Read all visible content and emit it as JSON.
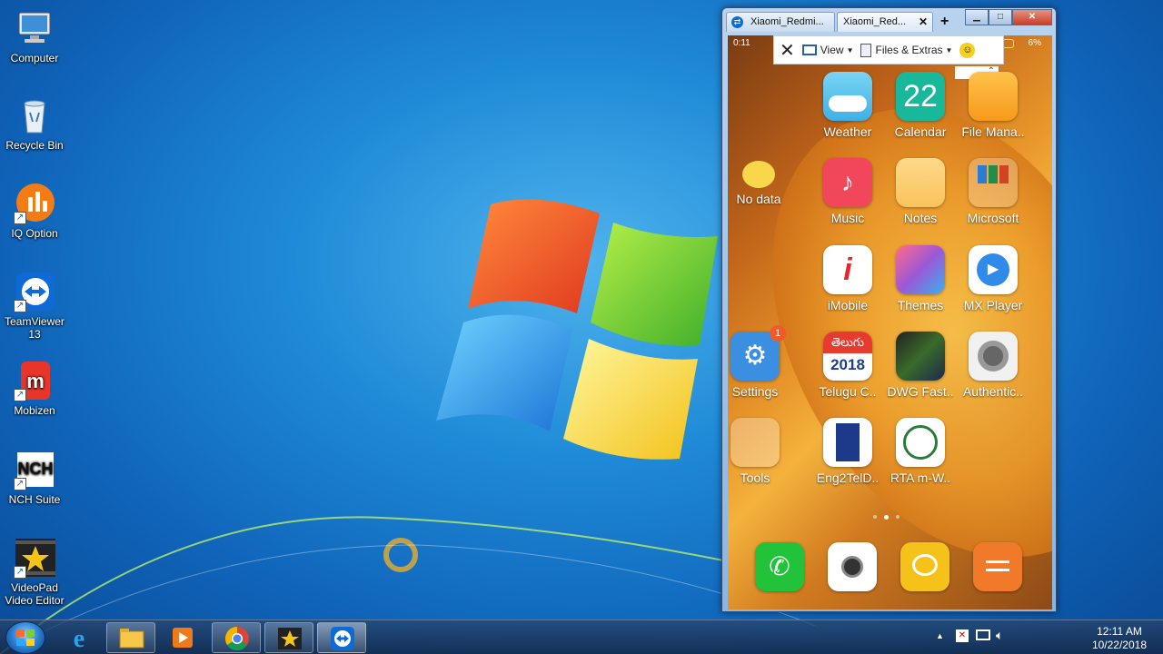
{
  "desktop": {
    "icons": [
      {
        "label": "Computer",
        "icon": "computer-icon"
      },
      {
        "label": "Recycle Bin",
        "icon": "recycle-bin-icon"
      },
      {
        "label": "IQ Option",
        "icon": "iq-option-icon"
      },
      {
        "label": "TeamViewer 13",
        "icon": "teamviewer-icon"
      },
      {
        "label": "Mobizen",
        "icon": "mobizen-icon"
      },
      {
        "label": "NCH Suite",
        "icon": "nch-suite-icon"
      },
      {
        "label": "VideoPad Video Editor",
        "icon": "videopad-icon"
      }
    ]
  },
  "teamviewer": {
    "tabs": [
      {
        "label": "Xiaomi_Redmi..."
      },
      {
        "label": "Xiaomi_Red..."
      }
    ],
    "toolbar": {
      "view_label": "View",
      "files_label": "Files & Extras"
    },
    "phone": {
      "status_time": "0:11",
      "battery": "6%",
      "weather_widget": "No data",
      "calendar_day": "22",
      "telugu_year": "2018",
      "telugu_text": "తెలుగు",
      "settings_badge": "1",
      "apps": [
        {
          "label": "Weather"
        },
        {
          "label": "Calendar"
        },
        {
          "label": "File Mana.."
        },
        {
          "label": "Music"
        },
        {
          "label": "Notes"
        },
        {
          "label": "Microsoft"
        },
        {
          "label": "iMobile"
        },
        {
          "label": "Themes"
        },
        {
          "label": "MX Player"
        },
        {
          "label": "Settings"
        },
        {
          "label": "Telugu C.."
        },
        {
          "label": "DWG Fast.."
        },
        {
          "label": "Authentic.."
        },
        {
          "label": "Tools"
        },
        {
          "label": "Eng2TelD.."
        },
        {
          "label": "RTA m-W.."
        }
      ],
      "dock": [
        "phone-app-icon",
        "camera-app-icon",
        "messaging-app-icon",
        "app-drawer-icon"
      ]
    }
  },
  "taskbar": {
    "pinned": [
      "internet-explorer-icon",
      "file-explorer-icon",
      "media-player-icon",
      "chrome-icon",
      "videopad-icon",
      "teamviewer-icon"
    ],
    "time": "12:11 AM",
    "date": "10/22/2018"
  },
  "colors": {
    "desktop_blue": "#1f8bd8",
    "taskbar": "#1b3a63",
    "close_red": "#c7402a"
  }
}
